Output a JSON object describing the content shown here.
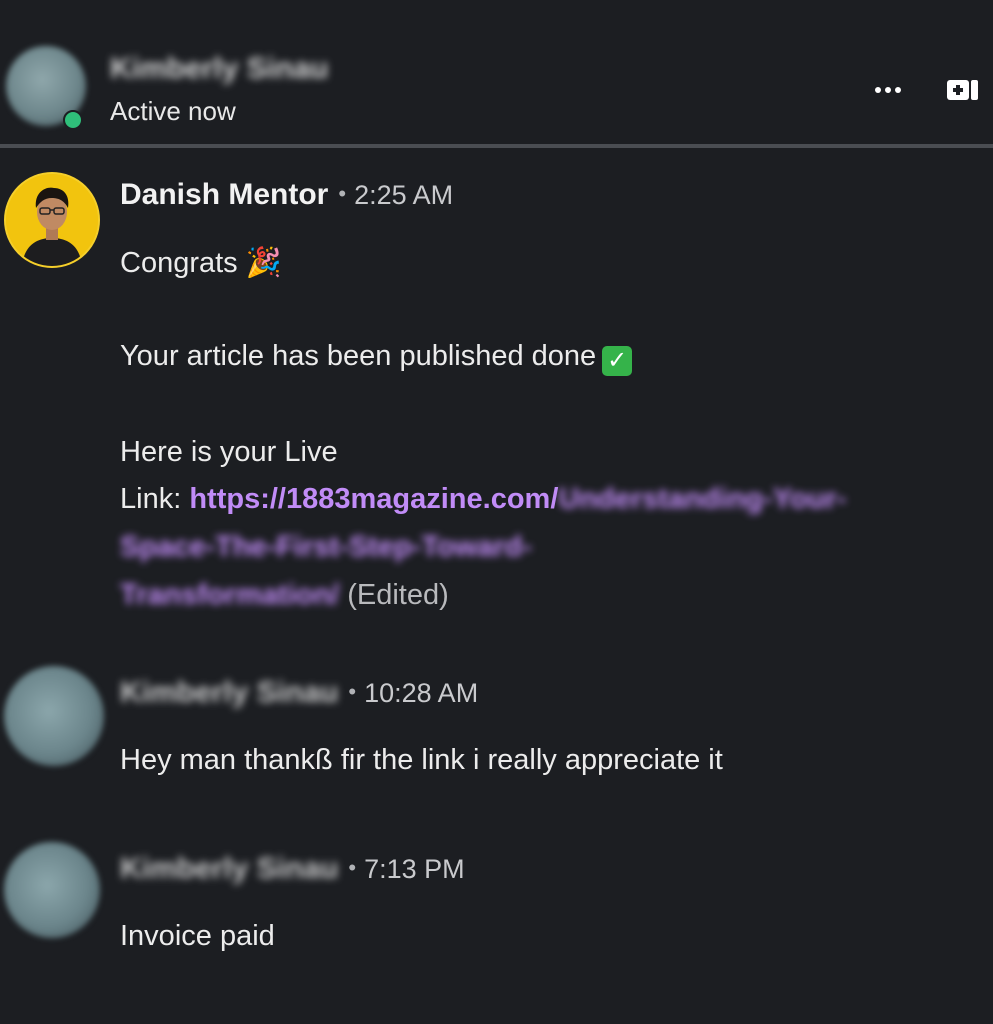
{
  "header": {
    "contact_name": "Kimberly Sinau",
    "status": "Active now"
  },
  "messages": [
    {
      "sender": "Danish Mentor",
      "separator": "•",
      "time": "2:25 AM",
      "lines": {
        "congrats": "Congrats 🎉",
        "published": "Your article has been published done",
        "live_intro": "Here is your Live",
        "link_label": "Link:",
        "link_visible": "https://1883magazine.com/",
        "link_blur_1": "Understanding-Your-",
        "link_blur_2": "Space-The-First-Step-Toward-",
        "link_blur_3": "Transformation/",
        "edited": "(Edited)"
      },
      "check_emoji": "✓"
    },
    {
      "sender": "Kimberly Sinau",
      "separator": "•",
      "time": "10:28 AM",
      "text": "Hey man thankß fir the link i really appreciate it"
    },
    {
      "sender": "Kimberly Sinau",
      "separator": "•",
      "time": "7:13 PM",
      "text": "Invoice paid"
    }
  ],
  "colors": {
    "background": "#1c1e22",
    "link": "#c18cf7",
    "presence": "#2fbf7a",
    "mentor_avatar_bg": "#f2c40e"
  },
  "icons": {
    "more": "more-horizontal-icon",
    "video": "video-call-icon"
  }
}
